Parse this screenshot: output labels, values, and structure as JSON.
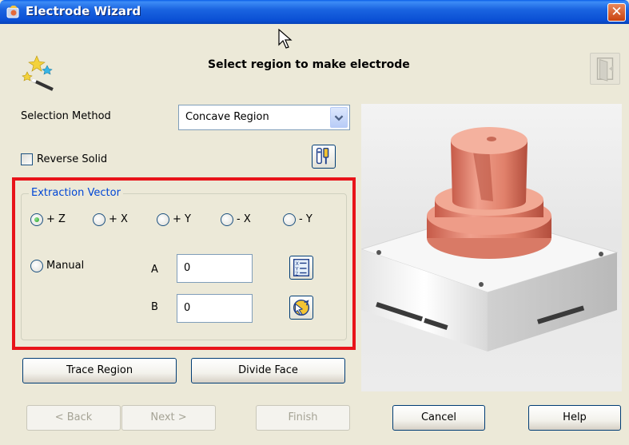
{
  "window": {
    "title": "Electrode Wizard",
    "close_glyph": "✕",
    "title_icon": "wizard-app-icon"
  },
  "header": {
    "heading": "Select region to make electrode",
    "wizard_icon": "magic-wand-icon",
    "exit_icon": "exit-door-icon"
  },
  "selection": {
    "label": "Selection Method",
    "value": "Concave Region"
  },
  "reverse_solid": {
    "label": "Reverse Solid",
    "checked": false
  },
  "extraction_vector": {
    "legend": "Extraction Vector",
    "options": [
      {
        "label": "+ Z",
        "selected": true
      },
      {
        "label": "+ X",
        "selected": false
      },
      {
        "label": "+ Y",
        "selected": false
      },
      {
        "label": "- X",
        "selected": false
      },
      {
        "label": "- Y",
        "selected": false
      }
    ],
    "manual_label": "Manual",
    "a_label": "A",
    "a_value": "0",
    "b_label": "B",
    "b_value": "0"
  },
  "actions": {
    "trace_region": "Trace Region",
    "divide_face": "Divide Face"
  },
  "footer": {
    "back": "< Back",
    "next": "Next >",
    "finish": "Finish",
    "cancel": "Cancel",
    "help": "Help"
  },
  "colors": {
    "highlight_box": "#E8141A",
    "title_bar": "#0A4FD4",
    "electrode": "#E2846E",
    "base": "#F2F2F2"
  }
}
